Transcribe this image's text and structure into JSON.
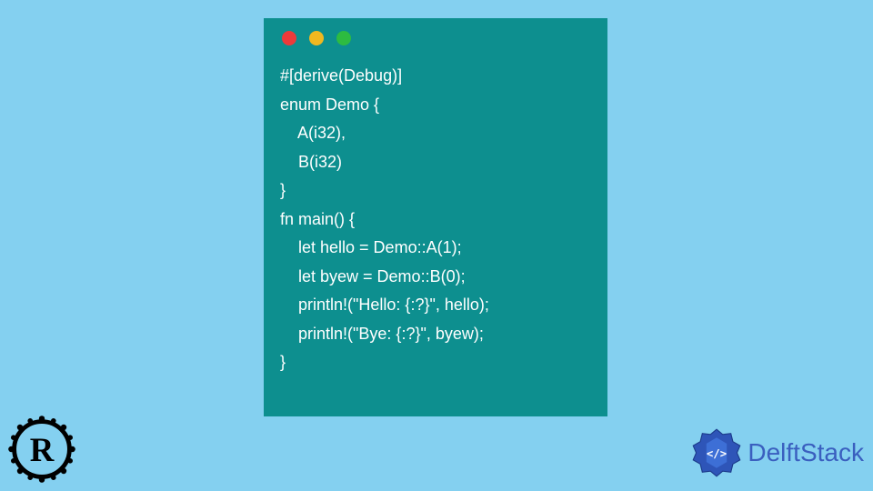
{
  "code": {
    "lines": [
      "#[derive(Debug)]",
      "enum Demo {",
      "    A(i32),",
      "    B(i32)",
      "}",
      "fn main() {",
      "    let hello = Demo::A(1);",
      "    let byew = Demo::B(0);",
      "    println!(\"Hello: {:?}\", hello);",
      "    println!(\"Bye: {:?}\", byew);",
      "}"
    ]
  },
  "window": {
    "dots": [
      "red",
      "yellow",
      "green"
    ]
  },
  "branding": {
    "rust_logo_alt": "Rust logo",
    "delft_text": "DelftStack",
    "delft_icon_alt": "DelftStack icon"
  },
  "colors": {
    "page_bg": "#84d0f0",
    "window_bg": "#0d8f8f",
    "code_text": "#ffffff",
    "delft_blue": "#3a5fbf"
  }
}
